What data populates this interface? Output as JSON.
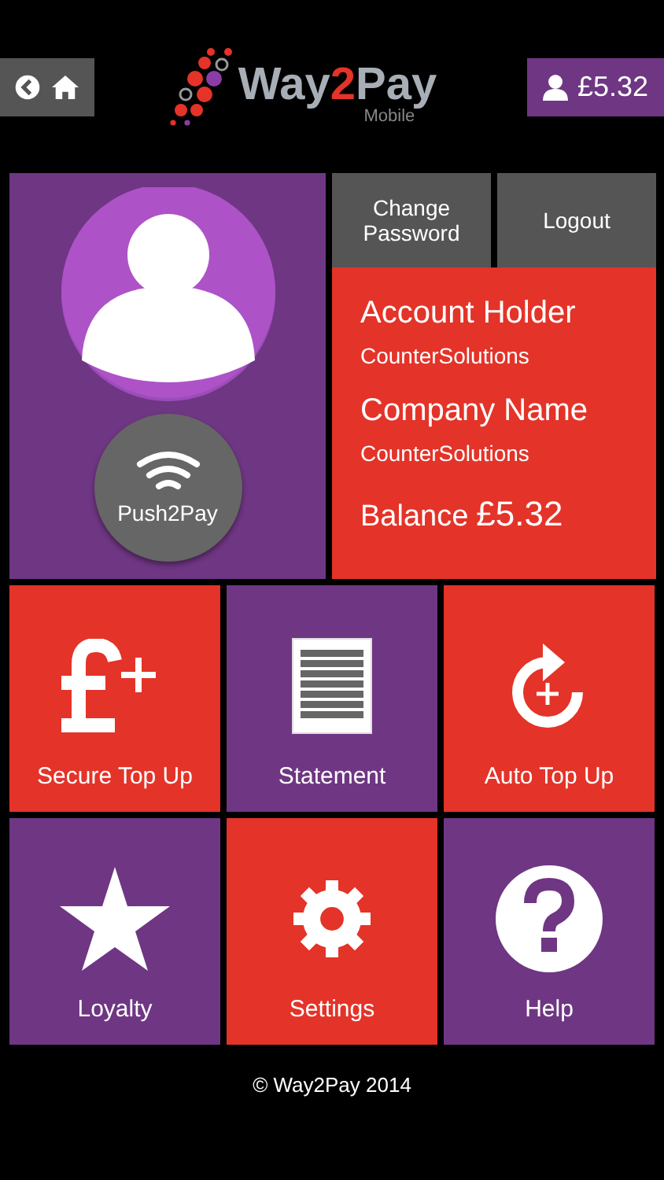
{
  "header": {
    "logo": {
      "before": "Way",
      "digit": "2",
      "after": "Pay",
      "subtitle": "Mobile"
    },
    "balance_button": "£5.32"
  },
  "profile": {
    "push_button": "Push2Pay"
  },
  "actions": [
    "Change Password",
    "Logout"
  ],
  "account": {
    "fields": [
      {
        "label": "Account Holder",
        "value": "CounterSolutions"
      },
      {
        "label": "Company Name",
        "value": "CounterSolutions"
      }
    ],
    "balance_label": "Balance",
    "balance_value": "£5.32"
  },
  "tiles": [
    {
      "label": "Secure Top Up",
      "kind": "topup",
      "color": "#e43328"
    },
    {
      "label": "Statement",
      "kind": "statement",
      "color": "#6f3683"
    },
    {
      "label": "Auto Top Up",
      "kind": "auto",
      "color": "#e43328"
    },
    {
      "label": "Loyalty",
      "kind": "loyalty",
      "color": "#6f3683"
    },
    {
      "label": "Settings",
      "kind": "settings",
      "color": "#e43328"
    },
    {
      "label": "Help",
      "kind": "help",
      "color": "#6f3683"
    }
  ],
  "footer": "© Way2Pay 2014"
}
